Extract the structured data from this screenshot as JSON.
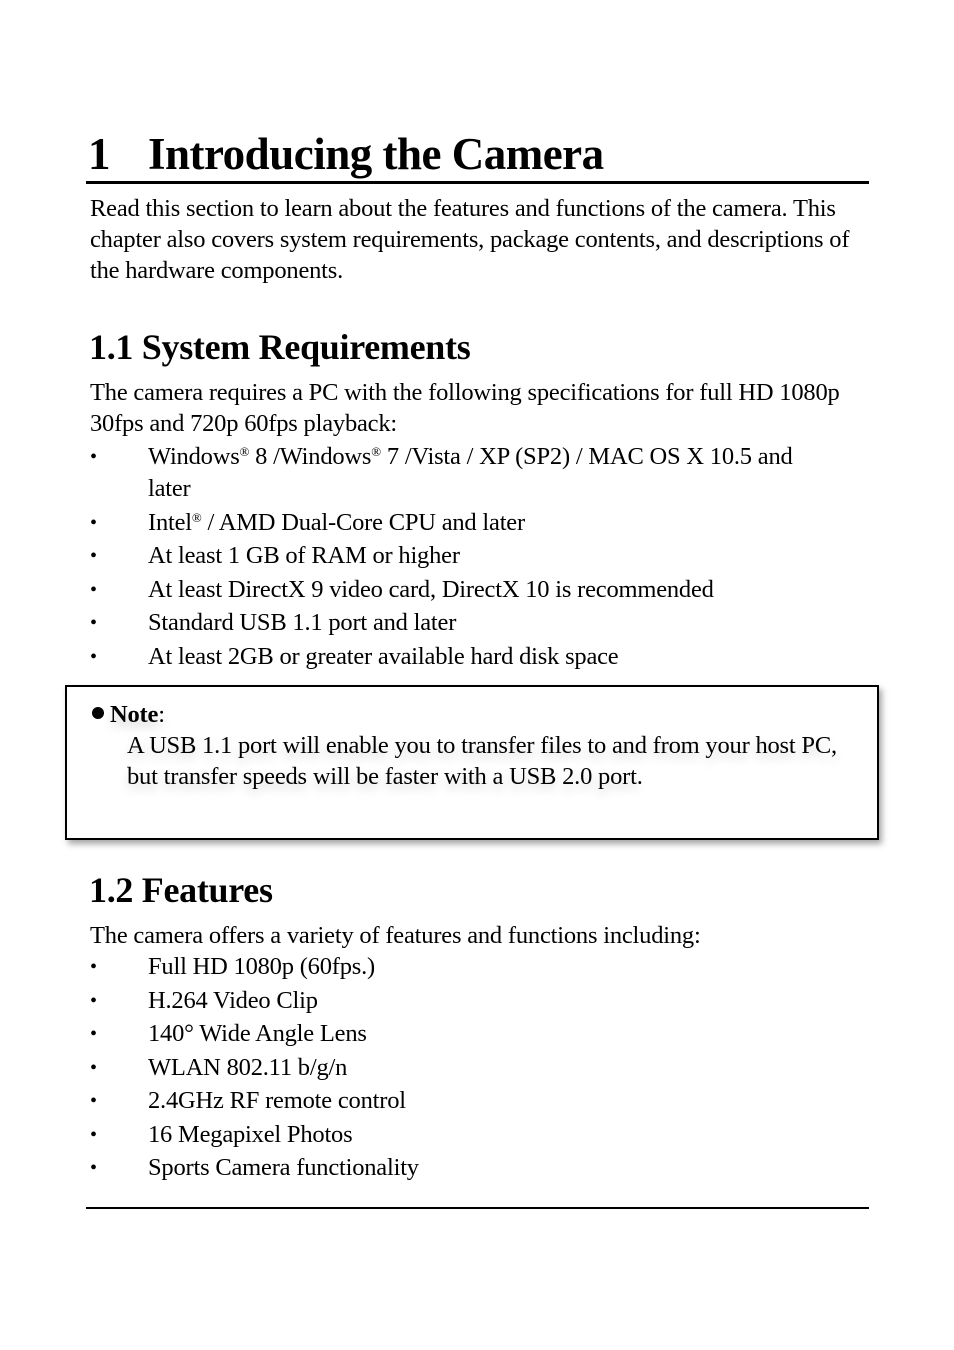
{
  "chapter": {
    "number": "1",
    "title": "Introducing the Camera",
    "intro": "Read this section to learn about the features and functions of the camera. This chapter also covers system requirements, package contents, and descriptions of the hardware components."
  },
  "system_requirements": {
    "heading": "1.1 System Requirements",
    "intro": "The camera requires a PC with the following specifications for full HD 1080p 30fps and 720p 60fps playback:",
    "bullet_glyph": "•",
    "items": [
      {
        "parts": [
          "Windows",
          "®",
          " 8 /Windows",
          "®",
          " 7 /Vista / XP (SP2) / MAC OS X 10.5 and later"
        ]
      },
      {
        "parts": [
          "Intel",
          "®",
          " / AMD Dual-Core CPU and later"
        ]
      },
      {
        "text": "At least 1 GB of RAM or higher"
      },
      {
        "text": "At least DirectX 9 video card, DirectX 10 is recommended"
      },
      {
        "text": "Standard USB 1.1 port and later"
      },
      {
        "text": "At least 2GB or greater available hard disk space"
      }
    ]
  },
  "note": {
    "title": "Note",
    "colon": ":",
    "body": "A USB 1.1 port will enable you to transfer files to and from your host PC, but transfer speeds will be faster with a USB 2.0 port."
  },
  "features": {
    "heading": "1.2 Features",
    "intro": "The camera offers a variety of features and functions including:",
    "bullet_glyph": "•",
    "items": [
      "Full HD 1080p (60fps.)",
      "H.264 Video Clip",
      "140° Wide Angle Lens",
      "WLAN 802.11 b/g/n",
      "2.4GHz RF remote control",
      "16 Megapixel Photos",
      "Sports Camera functionality"
    ]
  }
}
